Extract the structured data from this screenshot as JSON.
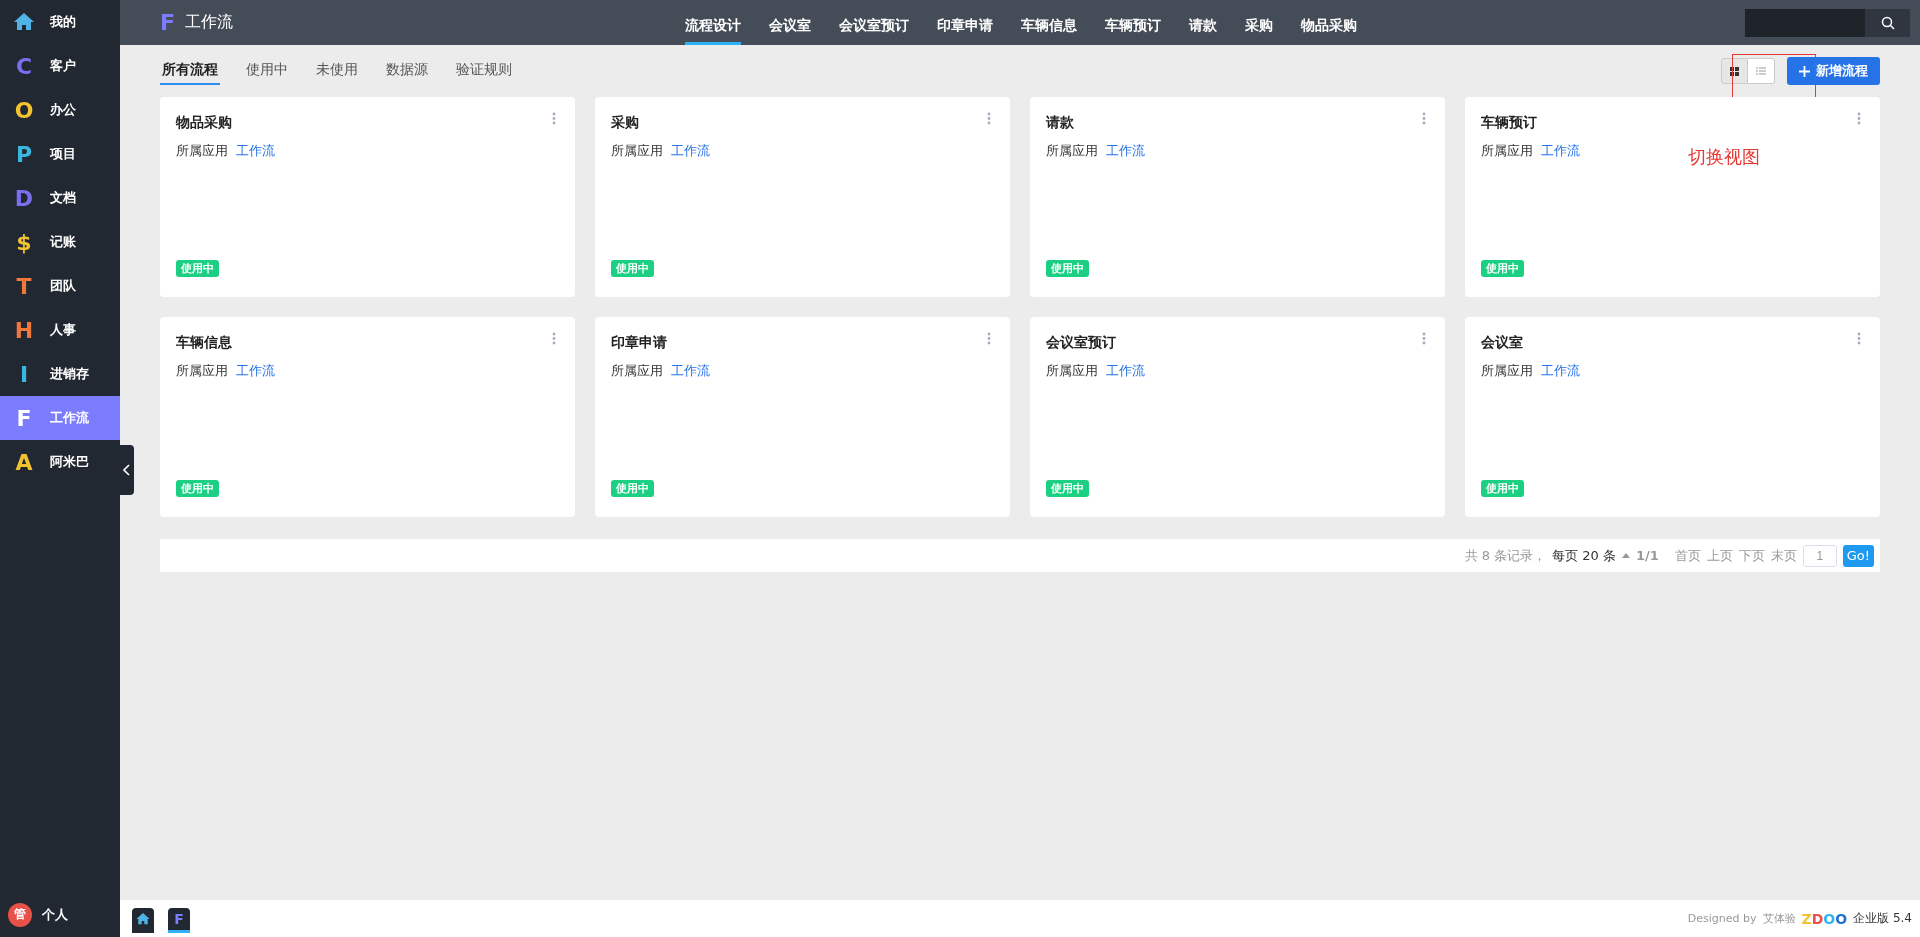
{
  "sidebar": {
    "items": [
      {
        "kind": "home",
        "label": "我的",
        "selected": false,
        "color": "#4fb3e8"
      },
      {
        "kind": "letter",
        "letter": "C",
        "label": "客户",
        "selected": false,
        "color": "#7b6ff0"
      },
      {
        "kind": "letter",
        "letter": "O",
        "label": "办公",
        "selected": false,
        "color": "#f2c230"
      },
      {
        "kind": "letter",
        "letter": "P",
        "label": "项目",
        "selected": false,
        "color": "#38b8e0"
      },
      {
        "kind": "letter",
        "letter": "D",
        "label": "文档",
        "selected": false,
        "color": "#7b6ff0"
      },
      {
        "kind": "letter",
        "letter": "$",
        "label": "记账",
        "selected": false,
        "color": "#f2c230"
      },
      {
        "kind": "letter",
        "letter": "T",
        "label": "团队",
        "selected": false,
        "color": "#f0763a"
      },
      {
        "kind": "letter",
        "letter": "H",
        "label": "人事",
        "selected": false,
        "color": "#f0763a"
      },
      {
        "kind": "letter",
        "letter": "I",
        "label": "进销存",
        "selected": false,
        "color": "#38b8e0"
      },
      {
        "kind": "letter",
        "letter": "F",
        "label": "工作流",
        "selected": true,
        "color": "#ffffff"
      },
      {
        "kind": "letter",
        "letter": "A",
        "label": "阿米巴",
        "selected": false,
        "color": "#f2c230"
      }
    ],
    "user": {
      "avatar": "管",
      "label": "个人"
    }
  },
  "topbar": {
    "logo_letter": "F",
    "title": "工作流",
    "nav": [
      {
        "label": "流程设计",
        "selected": true
      },
      {
        "label": "会议室",
        "selected": false
      },
      {
        "label": "会议室预订",
        "selected": false
      },
      {
        "label": "印章申请",
        "selected": false
      },
      {
        "label": "车辆信息",
        "selected": false
      },
      {
        "label": "车辆预订",
        "selected": false
      },
      {
        "label": "请款",
        "selected": false
      },
      {
        "label": "采购",
        "selected": false
      },
      {
        "label": "物品采购",
        "selected": false
      }
    ]
  },
  "tabs": [
    {
      "label": "所有流程",
      "selected": true
    },
    {
      "label": "使用中",
      "selected": false
    },
    {
      "label": "未使用",
      "selected": false
    },
    {
      "label": "数据源",
      "selected": false
    },
    {
      "label": "验证规则",
      "selected": false
    }
  ],
  "view_switch": [
    {
      "kind": "grid",
      "selected": true
    },
    {
      "kind": "list",
      "selected": false
    }
  ],
  "new_button": "新增流程",
  "annotation": "切换视图",
  "cards": [
    {
      "title": "物品采购",
      "app_label": "所属应用",
      "app": "工作流",
      "status": "使用中"
    },
    {
      "title": "采购",
      "app_label": "所属应用",
      "app": "工作流",
      "status": "使用中"
    },
    {
      "title": "请款",
      "app_label": "所属应用",
      "app": "工作流",
      "status": "使用中"
    },
    {
      "title": "车辆预订",
      "app_label": "所属应用",
      "app": "工作流",
      "status": "使用中"
    },
    {
      "title": "车辆信息",
      "app_label": "所属应用",
      "app": "工作流",
      "status": "使用中"
    },
    {
      "title": "印章申请",
      "app_label": "所属应用",
      "app": "工作流",
      "status": "使用中"
    },
    {
      "title": "会议室预订",
      "app_label": "所属应用",
      "app": "工作流",
      "status": "使用中"
    },
    {
      "title": "会议室",
      "app_label": "所属应用",
      "app": "工作流",
      "status": "使用中"
    }
  ],
  "pager": {
    "total": "共 8 条记录，",
    "per_page": "每页 20 条",
    "pages": "1/1",
    "links": [
      "首页",
      "上页",
      "下页",
      "末页"
    ],
    "page_input": "1",
    "go": "Go!"
  },
  "footer": {
    "apps": [
      {
        "kind": "home",
        "selected": false
      },
      {
        "kind": "letter",
        "letter": "F",
        "selected": true
      }
    ],
    "designed_by": "Designed by",
    "designer": "艾体验",
    "logo": "ZDOO",
    "edition": "企业版 5.4"
  }
}
